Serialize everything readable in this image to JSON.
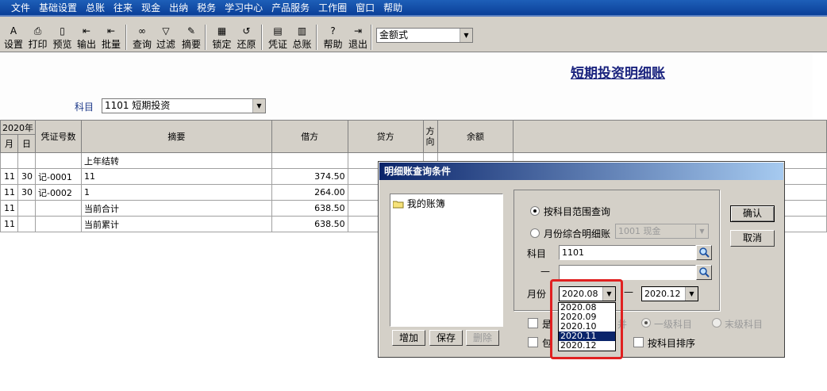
{
  "menu": [
    "文件",
    "基础设置",
    "总账",
    "往来",
    "现金",
    "出纳",
    "税务",
    "学习中心",
    "产品服务",
    "工作圈",
    "窗口",
    "帮助"
  ],
  "toolbar": {
    "buttons": [
      {
        "label": "设置",
        "icon": "settings-icon"
      },
      {
        "label": "打印",
        "icon": "printer-icon"
      },
      {
        "label": "预览",
        "icon": "preview-icon"
      },
      {
        "label": "输出",
        "icon": "export-icon"
      },
      {
        "label": "批量",
        "icon": "batch-icon"
      },
      {
        "label": "查询",
        "icon": "binoculars-icon"
      },
      {
        "label": "过滤",
        "icon": "filter-icon"
      },
      {
        "label": "摘要",
        "icon": "summary-icon"
      },
      {
        "label": "锁定",
        "icon": "lock-icon"
      },
      {
        "label": "还原",
        "icon": "restore-icon"
      },
      {
        "label": "凭证",
        "icon": "voucher-icon"
      },
      {
        "label": "总账",
        "icon": "ledger-icon"
      },
      {
        "label": "帮助",
        "icon": "help-icon"
      },
      {
        "label": "退出",
        "icon": "exit-icon"
      }
    ],
    "format_select": "金额式"
  },
  "report": {
    "title": "短期投资明细账",
    "subject_label": "科目",
    "subject_value": "1101 短期投资"
  },
  "ledger": {
    "year_header": "2020年",
    "month_header": "月",
    "day_header": "日",
    "voucher_header": "凭证号数",
    "summary_header": "摘要",
    "debit_header": "借方",
    "credit_header": "贷方",
    "direction_header": "方向",
    "balance_header": "余额",
    "rows": [
      {
        "month": "",
        "day": "",
        "voucher": "",
        "summary": "上年结转",
        "debit": ""
      },
      {
        "month": "11",
        "day": "30",
        "voucher": "记-0001",
        "summary": "11",
        "debit": "374.50"
      },
      {
        "month": "11",
        "day": "30",
        "voucher": "记-0002",
        "summary": "1",
        "debit": "264.00"
      },
      {
        "month": "11",
        "day": "",
        "voucher": "",
        "summary": "当前合计",
        "debit": "638.50"
      },
      {
        "month": "11",
        "day": "",
        "voucher": "",
        "summary": "当前累计",
        "debit": "638.50"
      }
    ]
  },
  "dialog": {
    "title": "明细账查询条件",
    "tree_item": "我的账簿",
    "add_button": "增加",
    "save_button": "保存",
    "delete_button": "删除",
    "confirm_button": "确认",
    "cancel_button": "取消",
    "radio_range": "按科目范围查询",
    "radio_monthly": "月份综合明细账",
    "monthly_account": "1001 现金",
    "subject_label": "科目",
    "subject_from": "1101",
    "dash_label": "—",
    "subject_to": "",
    "month_label": "月份",
    "month_from": "2020.08",
    "month_to": "2020.12",
    "month_options": [
      "2020.08",
      "2020.09",
      "2020.10",
      "2020.11",
      "2020.12"
    ],
    "month_selected": "2020.11",
    "check1_label": "是",
    "check1_tail": "并",
    "check2_label": "包",
    "radio_level1": "一级科目",
    "radio_last": "末级科目",
    "sort_by_subject": "按科目排序"
  }
}
